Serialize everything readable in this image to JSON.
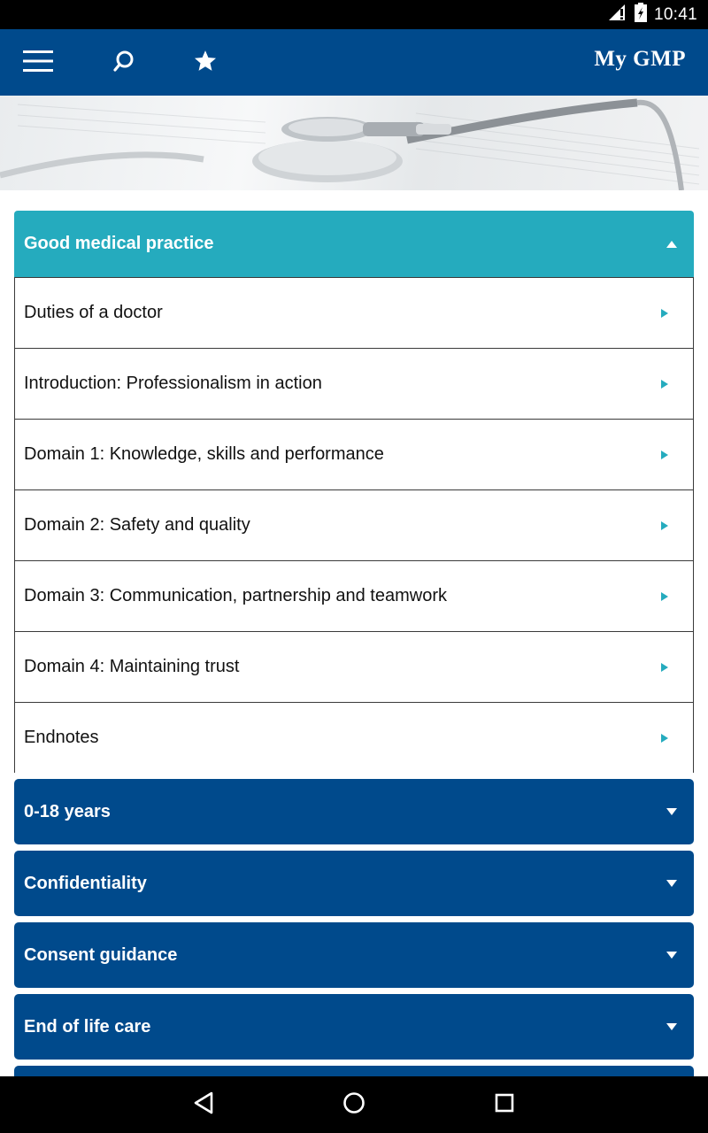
{
  "status_bar": {
    "time": "10:41",
    "icons": [
      "signal-icon",
      "battery-icon"
    ]
  },
  "app_bar": {
    "title": "My GMP",
    "icons": [
      "menu-icon",
      "search-icon",
      "star-icon"
    ],
    "background": "#004a8c"
  },
  "hero": {
    "image": "stethoscope-banner"
  },
  "sections": {
    "open": {
      "title": "Good medical practice",
      "color": "#25abbe",
      "items": [
        {
          "label": "Duties of a doctor"
        },
        {
          "label": "Introduction: Professionalism in action"
        },
        {
          "label": "Domain 1: Knowledge, skills and performance"
        },
        {
          "label": "Domain 2: Safety and quality"
        },
        {
          "label": "Domain 3: Communication, partnership and teamwork"
        },
        {
          "label": "Domain 4: Maintaining trust"
        },
        {
          "label": "Endnotes"
        }
      ]
    },
    "closed": [
      {
        "title": "0-18 years"
      },
      {
        "title": "Confidentiality"
      },
      {
        "title": "Consent guidance"
      },
      {
        "title": "End of life care"
      }
    ]
  },
  "nav_bar": {
    "icons": [
      "back-icon",
      "home-icon",
      "recents-icon"
    ]
  }
}
